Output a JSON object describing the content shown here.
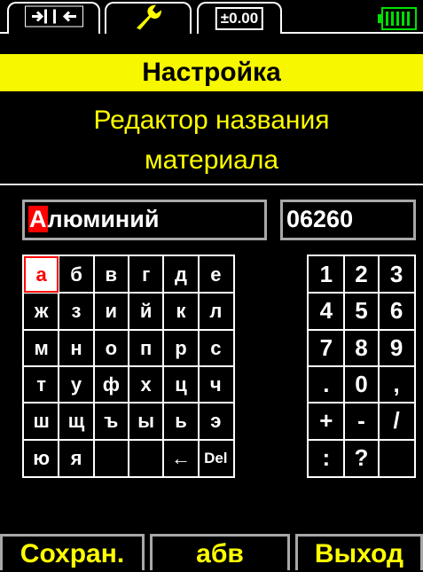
{
  "tabs": [
    {
      "name": "calibration",
      "icon": "split-arrows-icon"
    },
    {
      "name": "settings",
      "icon": "wrench-icon"
    },
    {
      "name": "zero",
      "icon": "zero-display-icon",
      "label": "±0.00"
    }
  ],
  "battery": {
    "level": 1.0,
    "color": "#00e000"
  },
  "header": {
    "title": "Настройка"
  },
  "subtitle": {
    "line1": "Редактор названия",
    "line2": "материала"
  },
  "name_field": {
    "cursor_char": "А",
    "rest": "люминий"
  },
  "code_field": {
    "value": "06260"
  },
  "letters": [
    [
      "а",
      "б",
      "в",
      "г",
      "д",
      "е"
    ],
    [
      "ж",
      "з",
      "и",
      "й",
      "к",
      "л"
    ],
    [
      "м",
      "н",
      "о",
      "п",
      "р",
      "с"
    ],
    [
      "т",
      "у",
      "ф",
      "х",
      "ц",
      "ч"
    ],
    [
      "ш",
      "щ",
      "ъ",
      "ы",
      "ь",
      "э"
    ],
    [
      "ю",
      "я",
      "",
      "",
      "←",
      "Del"
    ]
  ],
  "digits": [
    [
      "1",
      "2",
      "3"
    ],
    [
      "4",
      "5",
      "6"
    ],
    [
      "7",
      "8",
      "9"
    ],
    [
      ".",
      "0",
      ","
    ],
    [
      "+",
      "-",
      "/"
    ],
    [
      ":",
      "?",
      ""
    ]
  ],
  "bottom": {
    "save": "Сохран.",
    "mode": "абв",
    "exit": "Выход"
  },
  "colors": {
    "accent": "#ffff00",
    "header_bg": "#f7f700",
    "selection": "#ff0000"
  }
}
